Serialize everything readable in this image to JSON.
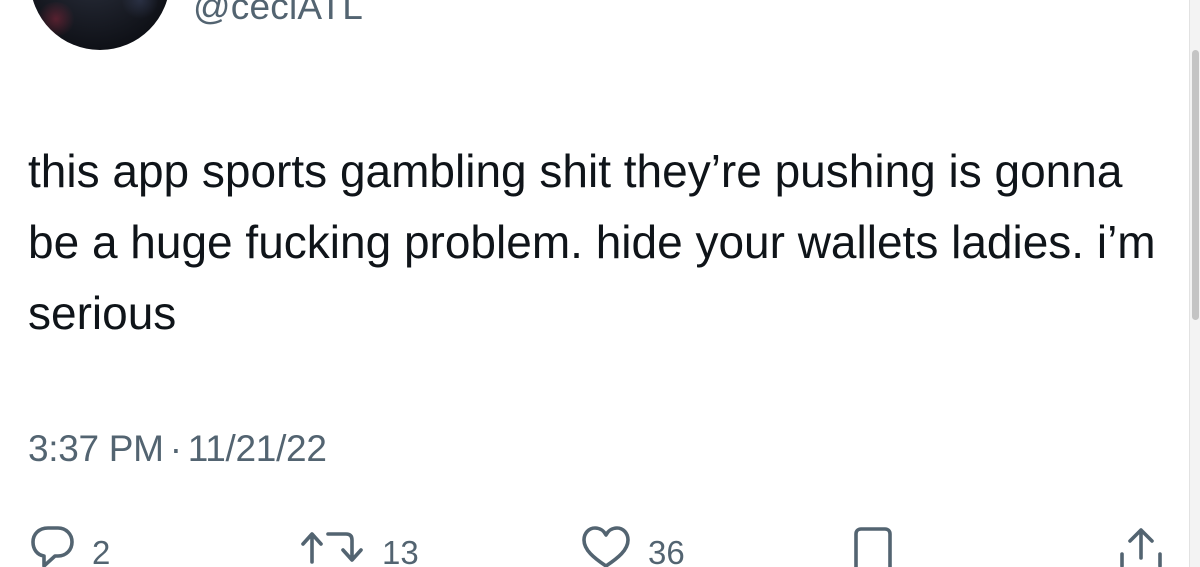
{
  "author": {
    "handle": "@ceciATL"
  },
  "tweet": {
    "text": "this app sports gambling shit they’re pushing is gonna be a huge fucking problem. hide your wallets ladies. i’m serious",
    "time": "3:37 PM",
    "separator": "·",
    "date": "11/21/22"
  },
  "actions": {
    "reply": {
      "icon": "reply-icon",
      "count": "2"
    },
    "retweet": {
      "icon": "retweet-icon",
      "count": "13"
    },
    "like": {
      "icon": "heart-icon",
      "count": "36"
    },
    "bookmark": {
      "icon": "bookmark-icon"
    },
    "share": {
      "icon": "share-icon"
    }
  },
  "colors": {
    "text": "#0f1419",
    "secondary": "#536471",
    "background": "#ffffff"
  }
}
